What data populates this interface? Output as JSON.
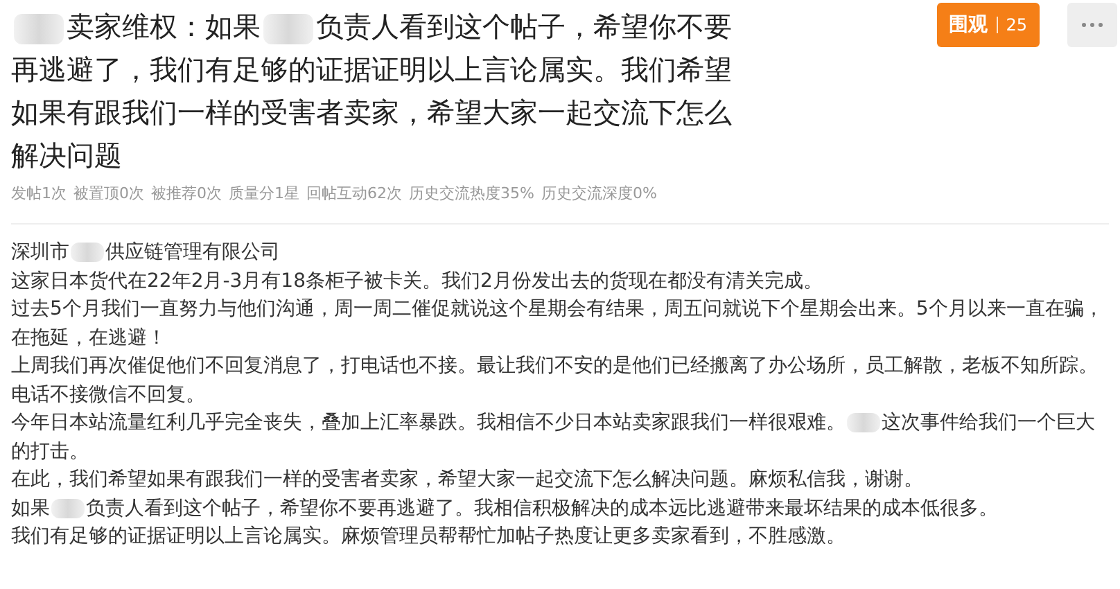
{
  "post": {
    "title": [
      {
        "kind": "redacted"
      },
      {
        "kind": "text",
        "text": "卖家维权：如果"
      },
      {
        "kind": "redacted"
      },
      {
        "kind": "text",
        "text": "负责人看到这个帖子，希望你不要再逃避了，我们有足够的证据证明以上言论属实。我们希望如果有跟我们一样的受害者卖家，希望大家一起交流下怎么解决问题"
      }
    ],
    "watch_button": {
      "label": "围观",
      "count": "25"
    },
    "stats": [
      "发帖1次",
      "被置顶0次",
      "被推荐0次",
      "质量分1星",
      "回帖互动62次",
      "历史交流热度35%",
      "历史交流深度0%"
    ],
    "body": [
      [
        {
          "kind": "text",
          "text": "深圳市"
        },
        {
          "kind": "redacted"
        },
        {
          "kind": "text",
          "text": "供应链管理有限公司"
        }
      ],
      [
        {
          "kind": "text",
          "text": "这家日本货代在22年2月-3月有18条柜子被卡关。我们2月份发出去的货现在都没有清关完成。"
        }
      ],
      [
        {
          "kind": "text",
          "text": "过去5个月我们一直努力与他们沟通，周一周二催促就说这个星期会有结果，周五问就说下个星期会出来。5个月以来一直在骗，在拖延，在逃避！"
        }
      ],
      [
        {
          "kind": "text",
          "text": "上周我们再次催促他们不回复消息了，打电话也不接。最让我们不安的是他们已经搬离了办公场所，员工解散，老板不知所踪。电话不接微信不回复。"
        }
      ],
      [
        {
          "kind": "text",
          "text": "今年日本站流量红利几乎完全丧失，叠加上汇率暴跌。我相信不少日本站卖家跟我们一样很艰难。"
        },
        {
          "kind": "redacted"
        },
        {
          "kind": "text",
          "text": "这次事件给我们一个巨大的打击。"
        }
      ],
      [
        {
          "kind": "text",
          "text": "在此，我们希望如果有跟我们一样的受害者卖家，希望大家一起交流下怎么解决问题。麻烦私信我，谢谢。"
        }
      ],
      [
        {
          "kind": "text",
          "text": "如果"
        },
        {
          "kind": "redacted"
        },
        {
          "kind": "text",
          "text": "负责人看到这个帖子，希望你不要再逃避了。我相信积极解决的成本远比逃避带来最坏结果的成本低很多。"
        }
      ],
      [
        {
          "kind": "text",
          "text": "我们有足够的证据证明以上言论属实。麻烦管理员帮帮忙加帖子热度让更多卖家看到，不胜感激。"
        }
      ]
    ]
  }
}
